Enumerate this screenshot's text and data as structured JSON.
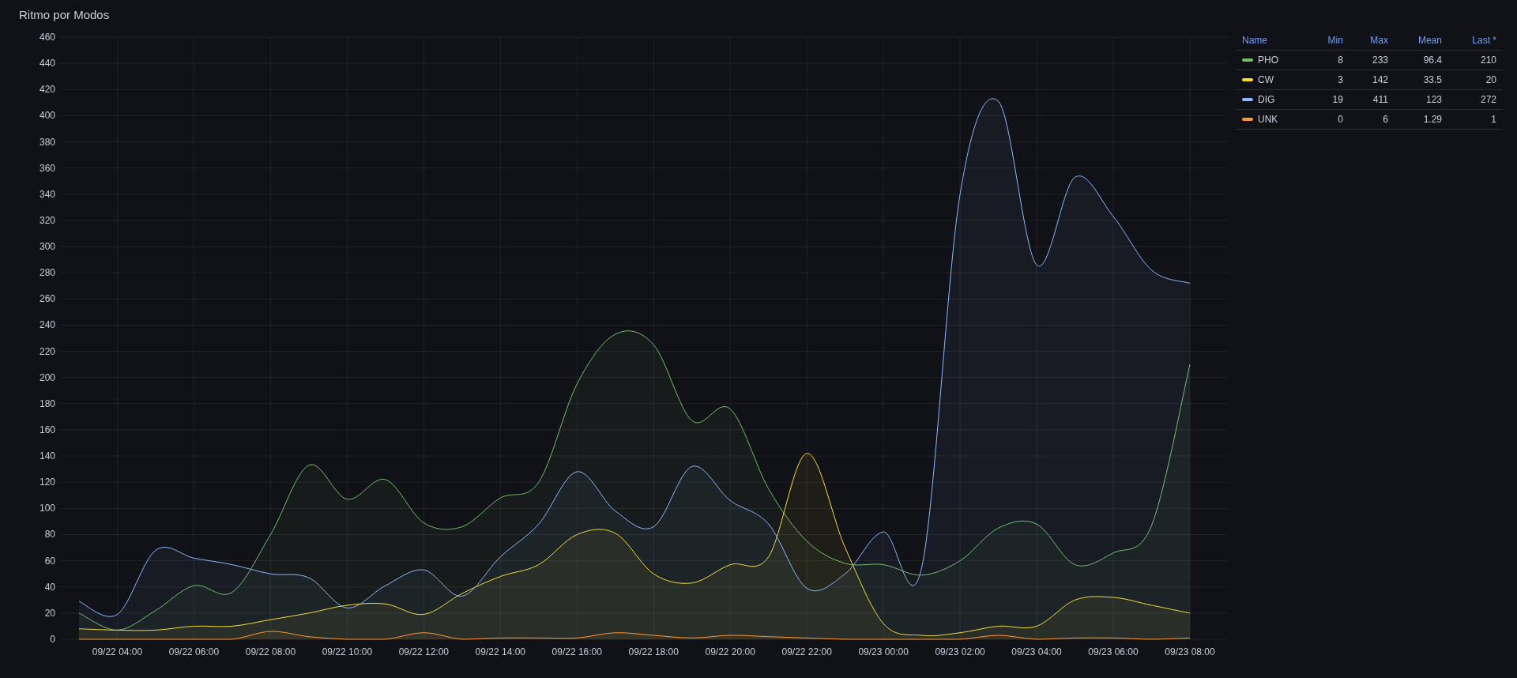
{
  "panel": {
    "title": "Ritmo por Modos"
  },
  "chart": {
    "chart_data": {
      "type": "area",
      "grid": true,
      "ylim": [
        0,
        460
      ],
      "categories": [
        null,
        "09/22 04:00",
        null,
        "09/22 06:00",
        null,
        "09/22 08:00",
        null,
        "09/22 10:00",
        null,
        "09/22 12:00",
        null,
        "09/22 14:00",
        null,
        "09/22 16:00",
        null,
        "09/22 18:00",
        null,
        "09/22 20:00",
        null,
        "09/22 22:00",
        null,
        "09/23 00:00",
        null,
        "09/23 02:00",
        null,
        "09/23 04:00",
        null,
        "09/23 06:00",
        null,
        "09/23 08:00"
      ],
      "yticks": [
        0,
        20,
        40,
        60,
        80,
        100,
        120,
        140,
        160,
        180,
        200,
        220,
        240,
        260,
        280,
        300,
        320,
        340,
        360,
        380,
        400,
        420,
        440,
        460
      ],
      "series": [
        {
          "name": "PHO",
          "color": "#73bf69",
          "values": [
            20,
            7,
            22,
            41,
            36,
            80,
            133,
            107,
            122,
            89,
            86,
            108,
            120,
            195,
            233,
            225,
            167,
            176,
            115,
            75,
            58,
            57,
            49,
            60,
            85,
            88,
            57,
            66,
            87,
            210
          ]
        },
        {
          "name": "CW",
          "color": "#fade2a",
          "values": [
            8,
            7,
            7,
            10,
            10,
            15,
            20,
            26,
            27,
            19,
            35,
            48,
            57,
            80,
            81,
            50,
            43,
            57,
            63,
            142,
            70,
            12,
            3,
            5,
            10,
            10,
            30,
            32,
            26,
            20
          ]
        },
        {
          "name": "DIG",
          "color": "#8ab8ff",
          "values": [
            29,
            19,
            68,
            62,
            57,
            50,
            47,
            24,
            41,
            53,
            33,
            63,
            88,
            128,
            98,
            86,
            132,
            106,
            88,
            39,
            50,
            82,
            55,
            340,
            411,
            286,
            353,
            323,
            282,
            272
          ]
        },
        {
          "name": "UNK",
          "color": "#ff9830",
          "values": [
            0,
            0,
            0,
            0,
            0,
            6,
            2,
            0,
            0,
            5,
            0,
            1,
            1,
            1,
            5,
            3,
            1,
            3,
            2,
            1,
            0,
            0,
            0,
            0,
            3,
            0,
            1,
            1,
            0,
            1
          ]
        }
      ]
    }
  },
  "legend": {
    "columns": [
      "Name",
      "Min",
      "Max",
      "Mean",
      "Last *"
    ],
    "rows": [
      {
        "min": "8",
        "max": "233",
        "mean": "96.4",
        "last": "210"
      },
      {
        "min": "3",
        "max": "142",
        "mean": "33.5",
        "last": "20"
      },
      {
        "min": "19",
        "max": "411",
        "mean": "123",
        "last": "272"
      },
      {
        "min": "0",
        "max": "6",
        "mean": "1.29",
        "last": "1"
      }
    ]
  }
}
